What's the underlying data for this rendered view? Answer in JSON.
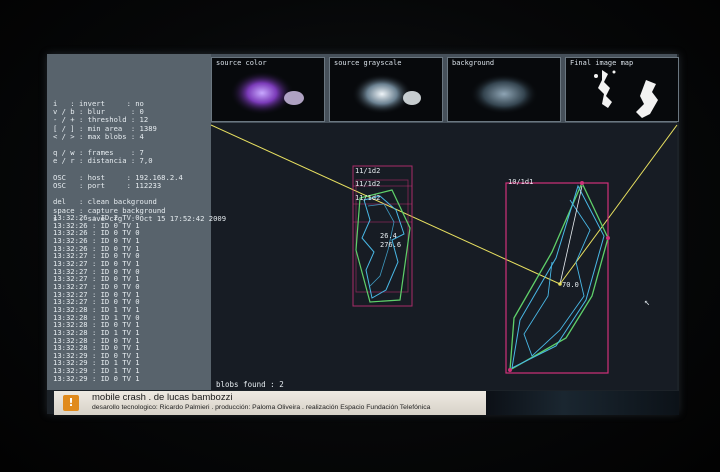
{
  "thumbnails": [
    {
      "label": "source color"
    },
    {
      "label": "source grayscale"
    },
    {
      "label": "background"
    },
    {
      "label": "Final image map"
    }
  ],
  "settings": [
    "i   : invert     : no",
    "v / b : blur      : 0",
    "- / + : threshold : 12",
    "[ / ] : min area  : 1389",
    "< / > : max blobs : 4",
    "",
    "q / w : frames    : 7",
    "e / r : distancia : 7,0",
    "",
    "OSC   : host     : 192.168.2.4",
    "OSC   : port     : 112233",
    "",
    "del   : clean background",
    "space : capture background",
    "s     : save cfg  : Oct 15 17:52:42 2009"
  ],
  "log": [
    "13:32:26 : ID 2 TV 0",
    "13:32:26 : ID 0 TV 1",
    "13:32:26 : ID 0 TV 0",
    "13:32:26 : ID 0 TV 1",
    "13:32:26 : ID 0 TV 1",
    "13:32:27 : ID 0 TV 0",
    "13:32:27 : ID 0 TV 1",
    "13:32:27 : ID 0 TV 0",
    "13:32:27 : ID 0 TV 1",
    "13:32:27 : ID 0 TV 0",
    "13:32:27 : ID 0 TV 1",
    "13:32:27 : ID 0 TV 0",
    "13:32:28 : ID 1 TV 1",
    "13:32:28 : ID 1 TV 0",
    "13:32:28 : ID 0 TV 1",
    "13:32:28 : ID 1 TV 1",
    "13:32:28 : ID 0 TV 1",
    "13:32:28 : ID 0 TV 1",
    "13:32:29 : ID 0 TV 1",
    "13:32:29 : ID 1 TV 1",
    "13:32:29 : ID 1 TV 1",
    "13:32:29 : ID 0 TV 1"
  ],
  "blobs": {
    "left_ids": [
      "11/1d2",
      "11/1d2",
      "11/1d2"
    ],
    "left_values": [
      "26.4",
      "276.6"
    ],
    "right_id": "10/1d1",
    "right_value": "70.0"
  },
  "status": {
    "blobs_found": "blobs found : 2"
  },
  "credits": {
    "icon": "!",
    "title": "mobile crash . de lucas bambozzi",
    "subtitle": "desarollo tecnologico: Ricardo Palmieri . producción: Paloma Oliveira . realización Espacio Fundación Telefónica"
  },
  "colors": {
    "accent_yellow": "#e8e060",
    "blob_box": "#d0307a",
    "hull_green": "#5fd06a",
    "contour_cyan": "#49b8e6"
  }
}
